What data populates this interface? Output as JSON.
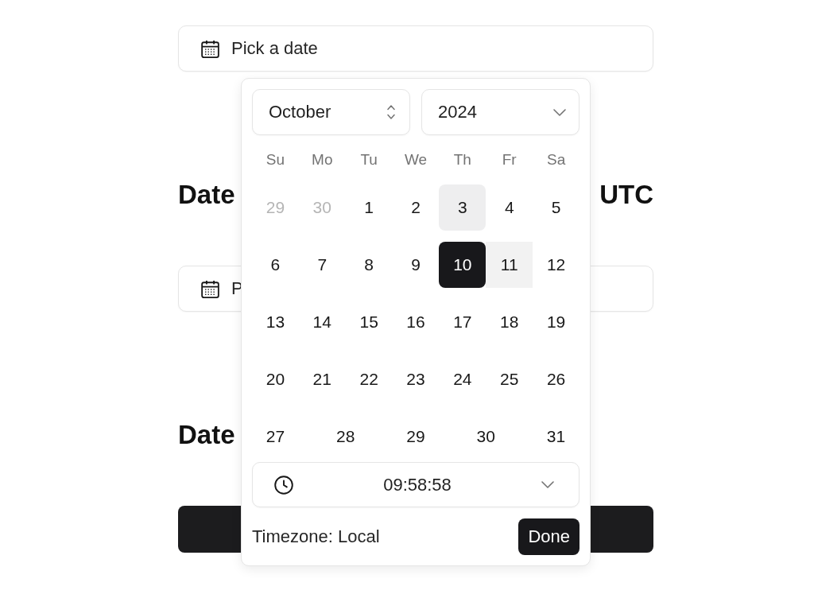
{
  "date_picker": {
    "label": "Pick a date"
  },
  "heading_1": {
    "start": "Date",
    "end": "UTC"
  },
  "date_picker_2": {
    "label": "P"
  },
  "heading_2": {
    "start": "Date"
  },
  "popover": {
    "month_select": {
      "value": "October"
    },
    "year_select": {
      "value": "2024"
    },
    "weekdays": [
      "Su",
      "Mo",
      "Tu",
      "We",
      "Th",
      "Fr",
      "Sa"
    ],
    "weeks": [
      {
        "days": [
          {
            "label": "29",
            "outside": true,
            "selected": false,
            "today": false,
            "in_range": false
          },
          {
            "label": "30",
            "outside": true,
            "selected": false,
            "today": false,
            "in_range": false
          },
          {
            "label": "1",
            "outside": false,
            "selected": false,
            "today": false,
            "in_range": false
          },
          {
            "label": "2",
            "outside": false,
            "selected": false,
            "today": false,
            "in_range": false
          },
          {
            "label": "3",
            "outside": false,
            "selected": false,
            "today": true,
            "in_range": false
          },
          {
            "label": "4",
            "outside": false,
            "selected": false,
            "today": false,
            "in_range": false
          },
          {
            "label": "5",
            "outside": false,
            "selected": false,
            "today": false,
            "in_range": false
          }
        ]
      },
      {
        "days": [
          {
            "label": "6",
            "outside": false,
            "selected": false,
            "today": false,
            "in_range": false
          },
          {
            "label": "7",
            "outside": false,
            "selected": false,
            "today": false,
            "in_range": false
          },
          {
            "label": "8",
            "outside": false,
            "selected": false,
            "today": false,
            "in_range": false
          },
          {
            "label": "9",
            "outside": false,
            "selected": false,
            "today": false,
            "in_range": false
          },
          {
            "label": "10",
            "outside": false,
            "selected": true,
            "today": false,
            "in_range": false
          },
          {
            "label": "11",
            "outside": false,
            "selected": false,
            "today": false,
            "in_range": true
          },
          {
            "label": "12",
            "outside": false,
            "selected": false,
            "today": false,
            "in_range": false
          }
        ]
      },
      {
        "days": [
          {
            "label": "13",
            "outside": false,
            "selected": false,
            "today": false,
            "in_range": false
          },
          {
            "label": "14",
            "outside": false,
            "selected": false,
            "today": false,
            "in_range": false
          },
          {
            "label": "15",
            "outside": false,
            "selected": false,
            "today": false,
            "in_range": false
          },
          {
            "label": "16",
            "outside": false,
            "selected": false,
            "today": false,
            "in_range": false
          },
          {
            "label": "17",
            "outside": false,
            "selected": false,
            "today": false,
            "in_range": false
          },
          {
            "label": "18",
            "outside": false,
            "selected": false,
            "today": false,
            "in_range": false
          },
          {
            "label": "19",
            "outside": false,
            "selected": false,
            "today": false,
            "in_range": false
          }
        ]
      },
      {
        "days": [
          {
            "label": "20",
            "outside": false,
            "selected": false,
            "today": false,
            "in_range": false
          },
          {
            "label": "21",
            "outside": false,
            "selected": false,
            "today": false,
            "in_range": false
          },
          {
            "label": "22",
            "outside": false,
            "selected": false,
            "today": false,
            "in_range": false
          },
          {
            "label": "23",
            "outside": false,
            "selected": false,
            "today": false,
            "in_range": false
          },
          {
            "label": "24",
            "outside": false,
            "selected": false,
            "today": false,
            "in_range": false
          },
          {
            "label": "25",
            "outside": false,
            "selected": false,
            "today": false,
            "in_range": false
          },
          {
            "label": "26",
            "outside": false,
            "selected": false,
            "today": false,
            "in_range": false
          }
        ]
      },
      {
        "days": [
          {
            "label": "27",
            "outside": false,
            "selected": false,
            "today": false,
            "in_range": false
          },
          {
            "label": "28",
            "outside": false,
            "selected": false,
            "today": false,
            "in_range": false
          },
          {
            "label": "29",
            "outside": false,
            "selected": false,
            "today": false,
            "in_range": false
          },
          {
            "label": "30",
            "outside": false,
            "selected": false,
            "today": false,
            "in_range": false
          },
          {
            "label": "31",
            "outside": false,
            "selected": false,
            "today": false,
            "in_range": false
          }
        ]
      }
    ],
    "time_select": {
      "value": "09:58:58"
    },
    "timezone": "Timezone: Local",
    "done_button": "Done"
  }
}
